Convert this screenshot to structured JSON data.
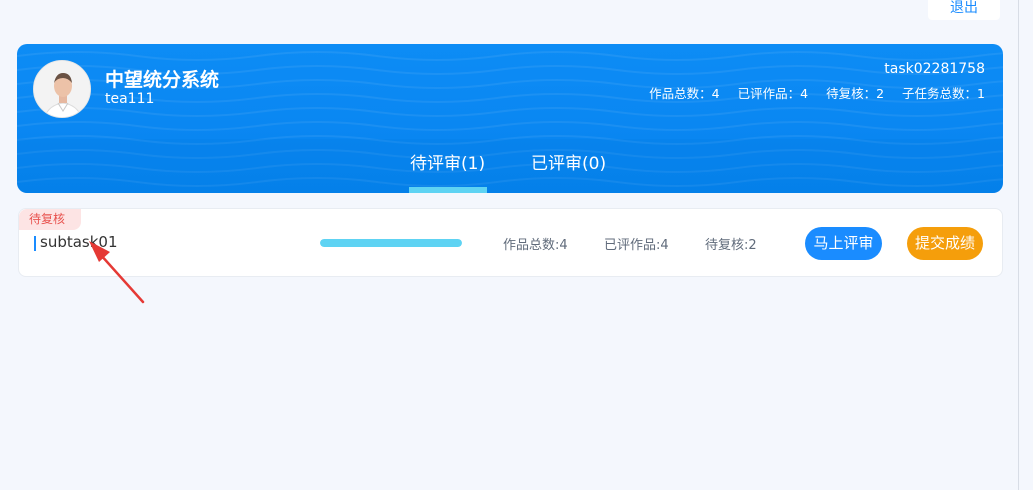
{
  "topbar": {
    "logout_label": "退出"
  },
  "header": {
    "system_title": "中望统分系统",
    "username": "tea111",
    "task_id": "task02281758",
    "stats": [
      {
        "label": "作品总数：4"
      },
      {
        "label": "已评作品：4"
      },
      {
        "label": "待复核：2"
      },
      {
        "label": "子任务总数：1"
      }
    ]
  },
  "tabs": [
    {
      "label": "待评审(1)",
      "active": true
    },
    {
      "label": "已评审(0)",
      "active": false
    }
  ],
  "subtasks": [
    {
      "badge": "待复核",
      "name": "subtask01",
      "progress": 1.0,
      "stat_total": "作品总数:4",
      "stat_reviewed": "已评作品:4",
      "stat_pending": "待复核:2",
      "review_button": "马上评审",
      "submit_button": "提交成绩"
    }
  ],
  "colors": {
    "primary": "#1a8cff",
    "accent": "#5ed3f3",
    "warning": "#f59e0b",
    "badge_bg": "#fde4e4",
    "badge_text": "#e8534f",
    "annotation_arrow": "#e53935"
  }
}
